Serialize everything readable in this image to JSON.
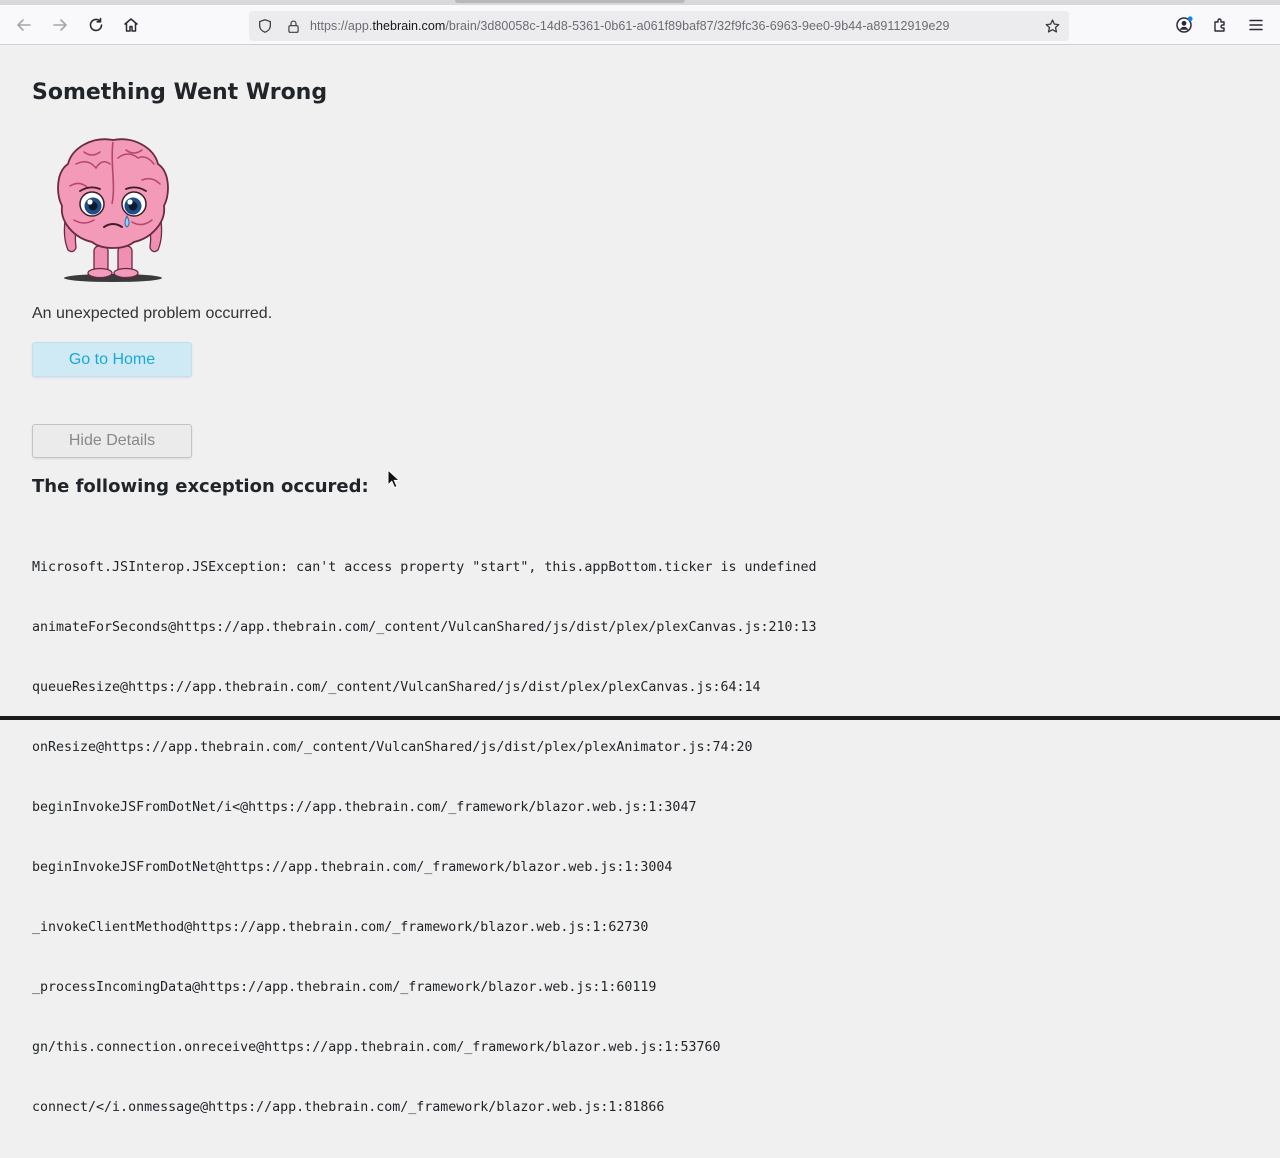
{
  "browser": {
    "url_prefix": "https://app.",
    "url_domain": "thebrain.com",
    "url_path": "/brain/3d80058c-14d8-5361-0b61-a061f89baf87/32f9fc36-6963-9ee0-9b44-a89112919e29",
    "icons": [
      "back-icon",
      "forward-icon",
      "reload-icon",
      "home-icon",
      "shield-icon",
      "lock-icon",
      "bookmark-star-icon",
      "account-icon",
      "extensions-icon",
      "menu-icon"
    ]
  },
  "page": {
    "title": "Something Went Wrong",
    "message": "An unexpected problem occurred.",
    "home_button": "Go to Home",
    "details_button": "Hide Details",
    "exception_heading": "The following exception occured:",
    "stack": [
      "Microsoft.JSInterop.JSException: can't access property \"start\", this.appBottom.ticker is undefined",
      "animateForSeconds@https://app.thebrain.com/_content/VulcanShared/js/dist/plex/plexCanvas.js:210:13",
      "queueResize@https://app.thebrain.com/_content/VulcanShared/js/dist/plex/plexCanvas.js:64:14",
      "onResize@https://app.thebrain.com/_content/VulcanShared/js/dist/plex/plexAnimator.js:74:20",
      "beginInvokeJSFromDotNet/i<@https://app.thebrain.com/_framework/blazor.web.js:1:3047",
      "beginInvokeJSFromDotNet@https://app.thebrain.com/_framework/blazor.web.js:1:3004",
      "_invokeClientMethod@https://app.thebrain.com/_framework/blazor.web.js:1:62730",
      "_processIncomingData@https://app.thebrain.com/_framework/blazor.web.js:1:60119",
      "gn/this.connection.onreceive@https://app.thebrain.com/_framework/blazor.web.js:1:53760",
      "connect/</i.onmessage@https://app.thebrain.com/_framework/blazor.web.js:1:81866"
    ]
  },
  "colors": {
    "page_bg": "#f0f0f0",
    "home_button_bg": "#cfe9f5",
    "home_button_text": "#1aa9d6",
    "brain_pink": "#f29ab8"
  }
}
